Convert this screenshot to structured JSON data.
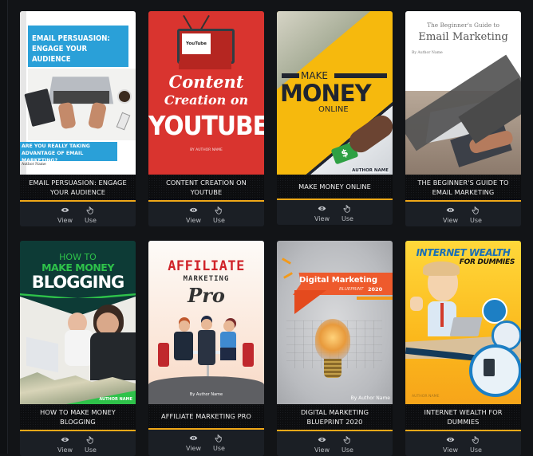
{
  "action_labels": {
    "view": "View",
    "use": "Use"
  },
  "templates": [
    {
      "title": "EMAIL PERSUASION: ENGAGE YOUR AUDIENCE",
      "cover": {
        "headline": "EMAIL PERSUASION: ENGAGE YOUR AUDIENCE",
        "subline": "ARE YOU REALLY TAKING ADVANTAGE OF EMAIL MARKETING?",
        "author": "Author Name"
      }
    },
    {
      "title": "CONTENT CREATION ON YOUTUBE",
      "cover": {
        "badge": "YouTube",
        "line1": "Content",
        "line2": "Creation on",
        "line3": "YOUTUBE",
        "author": "BY AUTHOR NAME"
      }
    },
    {
      "title": "MAKE MONEY ONLINE",
      "cover": {
        "line1": "MAKE",
        "line2": "MONEY",
        "line3": "ONLINE",
        "author": "AUTHOR NAME"
      }
    },
    {
      "title": "THE BEGINNER'S GUIDE TO EMAIL MARKETING",
      "cover": {
        "line1": "The Beginner's Guide to",
        "line2": "Email Marketing",
        "author": "By Author Name"
      }
    },
    {
      "title": "HOW TO MAKE MONEY BLOGGING",
      "cover": {
        "line1": "HOW TO",
        "line2": "MAKE MONEY",
        "line3": "BLOGGING",
        "author": "AUTHOR NAME"
      }
    },
    {
      "title": "AFFILIATE MARKETING PRO",
      "cover": {
        "line1": "AFFILIATE",
        "line2": "MARKETING",
        "line3": "Pro",
        "author": "By Author Name"
      }
    },
    {
      "title": "DIGITAL MARKETING BLUEPRINT 2020",
      "cover": {
        "line1": "Digital Marketing",
        "line2": "BLUEPRINT",
        "line3": "2020",
        "author": "By Author Name"
      }
    },
    {
      "title": "INTERNET WEALTH FOR DUMMIES",
      "cover": {
        "line1": "INTERNET WEALTH",
        "line2": "FOR DUMMIES",
        "author": "AUTHOR NAME"
      }
    }
  ],
  "colors": {
    "accent": "#f0a818",
    "background": "#121417",
    "card": "#1b1f25"
  }
}
